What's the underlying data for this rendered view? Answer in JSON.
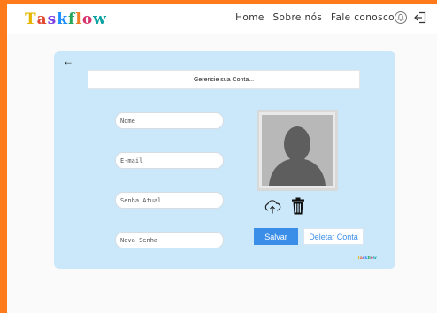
{
  "header": {
    "logo_text": "Taskflow",
    "logo_colors": [
      "#e5b500",
      "#e34a33",
      "#7b3fe4",
      "#1e90ff",
      "#26a65b",
      "#f48024",
      "#d6336c",
      "#0aa1a1"
    ],
    "nav": [
      {
        "label": "Home"
      },
      {
        "label": "Sobre nós"
      },
      {
        "label": "Fale conosco"
      }
    ],
    "icons": {
      "notifications": "bell-icon",
      "logout": "logout-icon"
    }
  },
  "card": {
    "back_icon": "←",
    "title": "Gerencie sua Conta...",
    "fields": {
      "name_placeholder": "Nome",
      "email_placeholder": "E-mail",
      "current_password_placeholder": "Senha Atual",
      "new_password_placeholder": "Nova Senha"
    },
    "photo_icons": {
      "upload": "cloud-upload-icon",
      "delete": "trash-icon"
    },
    "save_label": "Salvar",
    "delete_label": "Deletar Conta",
    "footer_logo": "Taskflow"
  },
  "colors": {
    "accent_orange": "#ff7a1a",
    "card_bg": "#cbe8fb",
    "primary_blue": "#3b8ee8"
  }
}
